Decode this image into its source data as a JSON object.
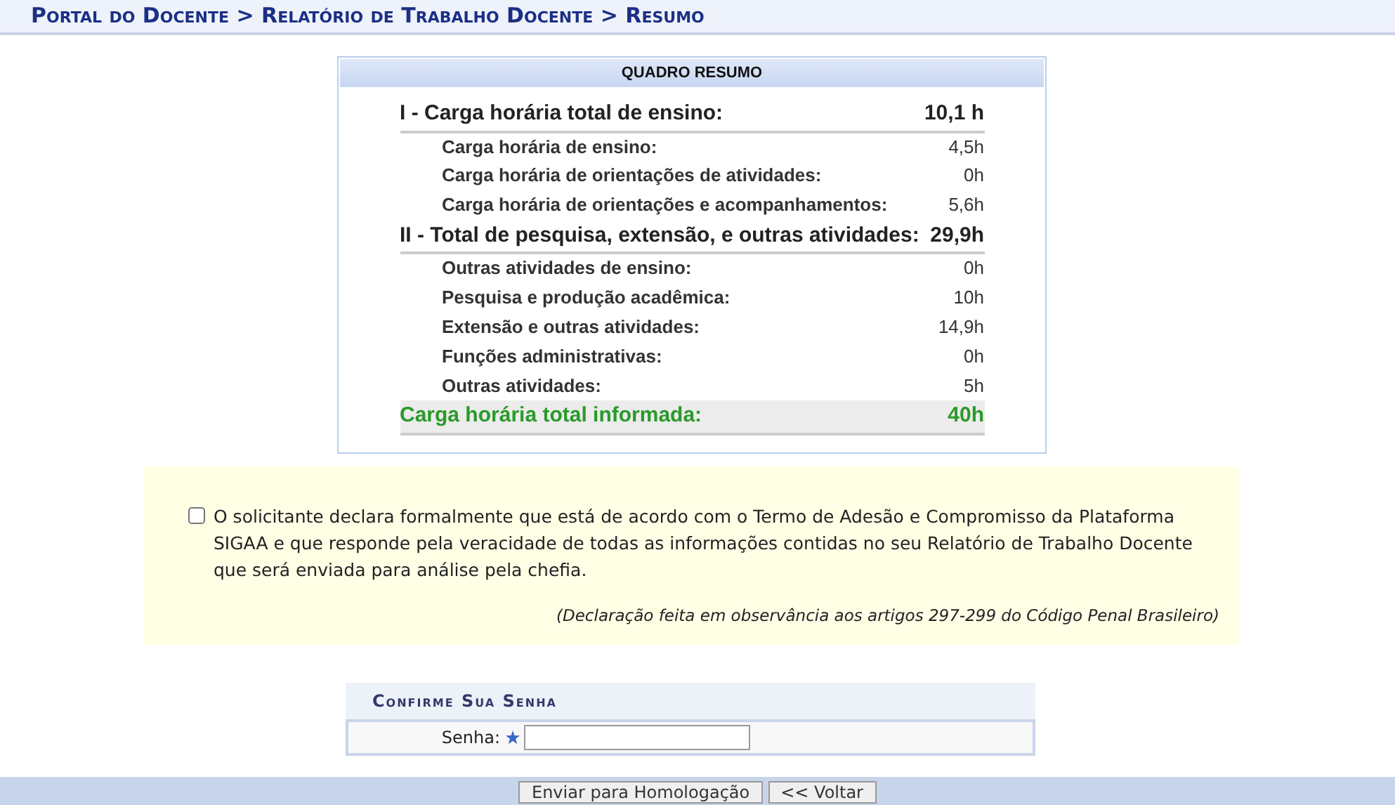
{
  "breadcrumb": "Portal do Docente > Relatório de Trabalho Docente > Resumo",
  "summary": {
    "title": "QUADRO RESUMO",
    "rows": [
      {
        "kind": "total",
        "label": "I - Carga horária total de ensino:",
        "value": "10,1 h"
      },
      {
        "kind": "item",
        "label": "Carga horária de ensino:",
        "value": "4,5h"
      },
      {
        "kind": "item",
        "label": "Carga horária de orientações de atividades:",
        "value": "0h"
      },
      {
        "kind": "item",
        "label": "Carga horária de orientações e acompanhamentos:",
        "value": "5,6h"
      },
      {
        "kind": "total",
        "label": "II - Total de pesquisa, extensão, e outras atividades:",
        "value": "29,9h"
      },
      {
        "kind": "item",
        "label": "Outras atividades de ensino:",
        "value": "0h"
      },
      {
        "kind": "item",
        "label": "Pesquisa e produção acadêmica:",
        "value": "10h"
      },
      {
        "kind": "item",
        "label": "Extensão e outras atividades:",
        "value": "14,9h"
      },
      {
        "kind": "item",
        "label": "Funções administrativas:",
        "value": "0h"
      },
      {
        "kind": "item",
        "label": "Outras atividades:",
        "value": "5h"
      },
      {
        "kind": "grand",
        "label": "Carga horária total informada:",
        "value": "40h"
      }
    ]
  },
  "declaration": {
    "checked": false,
    "text": "O solicitante declara formalmente que está de acordo com o Termo de Adesão e Compromisso da Plataforma SIGAA e que responde pela veracidade de todas as informações contidas no seu Relatório de Trabalho Docente que será enviada para análise pela chefia.",
    "note": "(Declaração feita em observância aos artigos 297-299 do Código Penal Brasileiro)"
  },
  "password": {
    "title": "Confirme Sua Senha",
    "label": "Senha:"
  },
  "buttons": [
    "Enviar para Homologação",
    "<< Voltar"
  ]
}
